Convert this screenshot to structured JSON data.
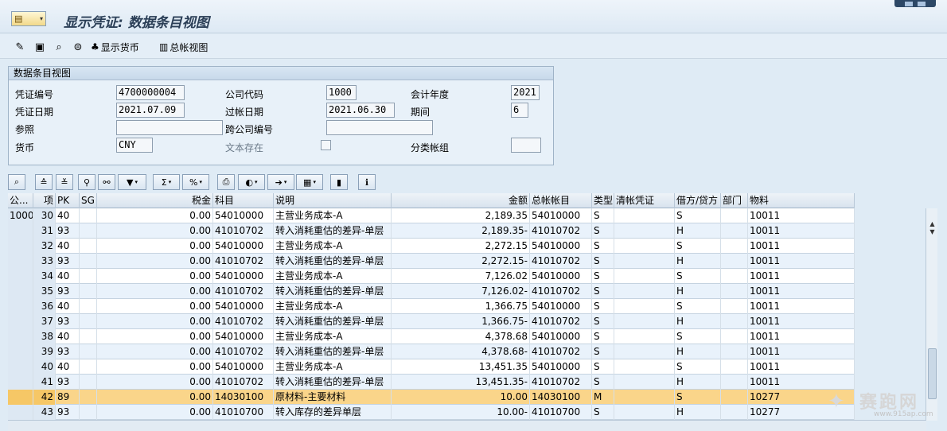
{
  "title": "显示凭证: 数据条目视图",
  "toolbar": {
    "show_currency": "显示货币",
    "ledger_view": "总帐视图"
  },
  "header_panel": {
    "title": "数据条目视图",
    "doc_no_label": "凭证编号",
    "doc_no": "4700000004",
    "company_code_label": "公司代码",
    "company_code": "1000",
    "fiscal_year_label": "会计年度",
    "fiscal_year": "2021",
    "doc_date_label": "凭证日期",
    "doc_date": "2021.07.09",
    "posting_date_label": "过帐日期",
    "posting_date": "2021.06.30",
    "period_label": "期间",
    "period": "6",
    "reference_label": "参照",
    "reference": "",
    "cross_cc_label": "跨公司编号",
    "cross_cc": "",
    "currency_label": "货币",
    "currency": "CNY",
    "text_exists_label": "文本存在",
    "ledger_group_label": "分类帐组",
    "ledger_group": ""
  },
  "grid": {
    "columns": {
      "cc": "公...",
      "item": "项",
      "pk": "PK",
      "sg": "SG",
      "tax": "税金",
      "account": "科目",
      "desc": "说明",
      "amount": "金额",
      "gl": "总帐帐目",
      "type": "类型",
      "clearing": "清帐凭证",
      "dc": "借方/贷方",
      "dept": "部门",
      "material": "物料"
    },
    "rows": [
      {
        "cc": "1000",
        "item": "30",
        "pk": "40",
        "sg": "",
        "tax": "0.00",
        "account": "54010000",
        "desc": "主营业务成本-A",
        "amount": "2,189.35",
        "gl": "54010000",
        "type": "S",
        "clearing": "",
        "dc": "S",
        "dept": "",
        "material": "10011"
      },
      {
        "cc": "",
        "item": "31",
        "pk": "93",
        "sg": "",
        "tax": "0.00",
        "account": "41010702",
        "desc": "转入消耗重估的差异-单层",
        "amount": "2,189.35-",
        "gl": "41010702",
        "type": "S",
        "clearing": "",
        "dc": "H",
        "dept": "",
        "material": "10011"
      },
      {
        "cc": "",
        "item": "32",
        "pk": "40",
        "sg": "",
        "tax": "0.00",
        "account": "54010000",
        "desc": "主营业务成本-A",
        "amount": "2,272.15",
        "gl": "54010000",
        "type": "S",
        "clearing": "",
        "dc": "S",
        "dept": "",
        "material": "10011"
      },
      {
        "cc": "",
        "item": "33",
        "pk": "93",
        "sg": "",
        "tax": "0.00",
        "account": "41010702",
        "desc": "转入消耗重估的差异-单层",
        "amount": "2,272.15-",
        "gl": "41010702",
        "type": "S",
        "clearing": "",
        "dc": "H",
        "dept": "",
        "material": "10011"
      },
      {
        "cc": "",
        "item": "34",
        "pk": "40",
        "sg": "",
        "tax": "0.00",
        "account": "54010000",
        "desc": "主营业务成本-A",
        "amount": "7,126.02",
        "gl": "54010000",
        "type": "S",
        "clearing": "",
        "dc": "S",
        "dept": "",
        "material": "10011"
      },
      {
        "cc": "",
        "item": "35",
        "pk": "93",
        "sg": "",
        "tax": "0.00",
        "account": "41010702",
        "desc": "转入消耗重估的差异-单层",
        "amount": "7,126.02-",
        "gl": "41010702",
        "type": "S",
        "clearing": "",
        "dc": "H",
        "dept": "",
        "material": "10011"
      },
      {
        "cc": "",
        "item": "36",
        "pk": "40",
        "sg": "",
        "tax": "0.00",
        "account": "54010000",
        "desc": "主营业务成本-A",
        "amount": "1,366.75",
        "gl": "54010000",
        "type": "S",
        "clearing": "",
        "dc": "S",
        "dept": "",
        "material": "10011"
      },
      {
        "cc": "",
        "item": "37",
        "pk": "93",
        "sg": "",
        "tax": "0.00",
        "account": "41010702",
        "desc": "转入消耗重估的差异-单层",
        "amount": "1,366.75-",
        "gl": "41010702",
        "type": "S",
        "clearing": "",
        "dc": "H",
        "dept": "",
        "material": "10011"
      },
      {
        "cc": "",
        "item": "38",
        "pk": "40",
        "sg": "",
        "tax": "0.00",
        "account": "54010000",
        "desc": "主营业务成本-A",
        "amount": "4,378.68",
        "gl": "54010000",
        "type": "S",
        "clearing": "",
        "dc": "S",
        "dept": "",
        "material": "10011"
      },
      {
        "cc": "",
        "item": "39",
        "pk": "93",
        "sg": "",
        "tax": "0.00",
        "account": "41010702",
        "desc": "转入消耗重估的差异-单层",
        "amount": "4,378.68-",
        "gl": "41010702",
        "type": "S",
        "clearing": "",
        "dc": "H",
        "dept": "",
        "material": "10011"
      },
      {
        "cc": "",
        "item": "40",
        "pk": "40",
        "sg": "",
        "tax": "0.00",
        "account": "54010000",
        "desc": "主营业务成本-A",
        "amount": "13,451.35",
        "gl": "54010000",
        "type": "S",
        "clearing": "",
        "dc": "S",
        "dept": "",
        "material": "10011"
      },
      {
        "cc": "",
        "item": "41",
        "pk": "93",
        "sg": "",
        "tax": "0.00",
        "account": "41010702",
        "desc": "转入消耗重估的差异-单层",
        "amount": "13,451.35-",
        "gl": "41010702",
        "type": "S",
        "clearing": "",
        "dc": "H",
        "dept": "",
        "material": "10011"
      },
      {
        "cc": "",
        "item": "42",
        "pk": "89",
        "sg": "",
        "tax": "0.00",
        "account": "14030100",
        "desc": "原材料-主要材料",
        "amount": "10.00",
        "gl": "14030100",
        "type": "M",
        "clearing": "",
        "dc": "S",
        "dept": "",
        "material": "10277",
        "selected": true
      },
      {
        "cc": "",
        "item": "43",
        "pk": "93",
        "sg": "",
        "tax": "0.00",
        "account": "41010700",
        "desc": "转入库存的差异单层",
        "amount": "10.00-",
        "gl": "41010700",
        "type": "S",
        "clearing": "",
        "dc": "H",
        "dept": "",
        "material": "10277"
      }
    ]
  },
  "watermark": {
    "text": "赛跑网",
    "url": "www.915ap.com"
  }
}
